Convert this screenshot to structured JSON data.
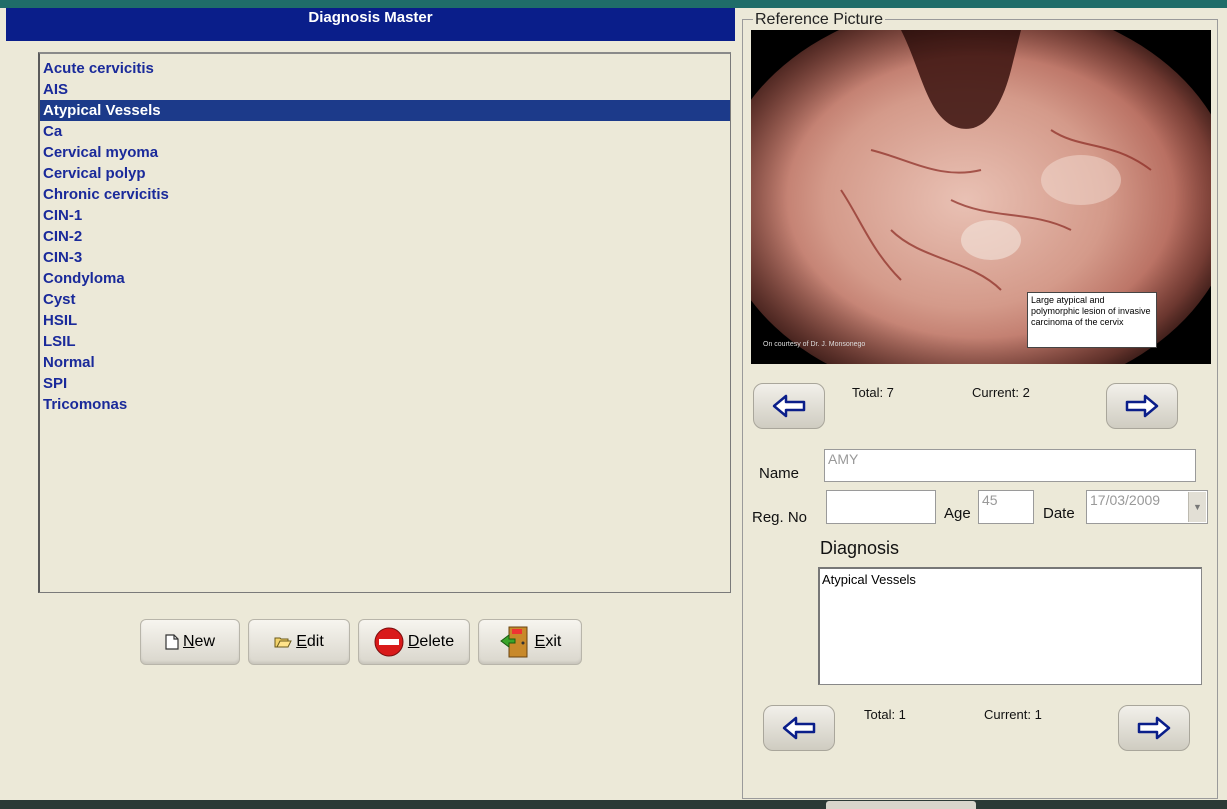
{
  "left_panel": {
    "title": "Diagnosis Master",
    "selected_index": 2,
    "items": [
      "Acute cervicitis",
      "AIS",
      "Atypical Vessels",
      "Ca",
      "Cervical myoma",
      "Cervical polyp",
      "Chronic cervicitis",
      "CIN-1",
      "CIN-2",
      "CIN-3",
      "Condyloma",
      "Cyst",
      "HSIL",
      "LSIL",
      "Normal",
      "SPI",
      "Tricomonas"
    ]
  },
  "buttons": {
    "new": {
      "accel": "N",
      "rest": "ew"
    },
    "edit": {
      "accel": "E",
      "rest": "dit"
    },
    "delete": {
      "accel": "D",
      "rest": "elete"
    },
    "exit": {
      "accel": "E",
      "rest": "xit"
    }
  },
  "reference_picture": {
    "legend": "Reference Picture",
    "caption": "Large atypical and polymorphic lesion of invasive carcinoma of the cervix",
    "credit": "On courtesy of Dr. J. Monsonego",
    "total": "Total: 7",
    "current": "Current: 2"
  },
  "patient": {
    "name_label": "Name",
    "name_value": "AMY",
    "regno_label": "Reg. No",
    "regno_value": "",
    "age_label": "Age",
    "age_value": "45",
    "date_label": "Date",
    "date_value": "17/03/2009",
    "diagnosis_label": "Diagnosis",
    "diagnosis_value": "Atypical Vessels",
    "total": "Total: 1",
    "current": "Current: 1"
  },
  "icons": [
    "new-document-icon",
    "open-folder-icon",
    "no-entry-icon",
    "exit-door-icon",
    "arrow-left-icon",
    "arrow-right-icon",
    "chevron-down-icon"
  ],
  "colors": {
    "title_bar": "#0a1e8a",
    "list_text": "#1a2a9a",
    "selection": "#1c3a8a",
    "background": "#ece9d8"
  }
}
